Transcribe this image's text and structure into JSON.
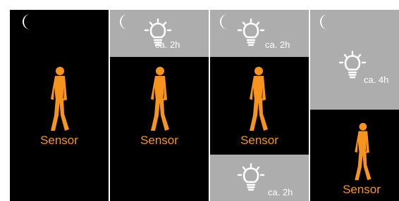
{
  "colors": {
    "background_dark": "#000000",
    "background_grey": "#adadad",
    "sensor_orange": "#f7941d",
    "icon_white": "#ffffff"
  },
  "icons": {
    "night": "crescent-moon-icon",
    "light": "light-bulb-icon",
    "sensor": "walking-person-icon"
  },
  "panels": [
    {
      "id": "panel-1",
      "moon": true,
      "sensor_label": "Sensor"
    },
    {
      "id": "panel-2",
      "moon": true,
      "light_duration": "ca. 2h",
      "sensor_label": "Sensor"
    },
    {
      "id": "panel-3",
      "moon": true,
      "light_duration": "ca. 2h",
      "sensor_label": "Sensor",
      "bottom_light_duration": "ca. 2h"
    },
    {
      "id": "panel-4",
      "moon": true,
      "light_duration": "ca. 4h",
      "sensor_label": "Sensor"
    }
  ]
}
